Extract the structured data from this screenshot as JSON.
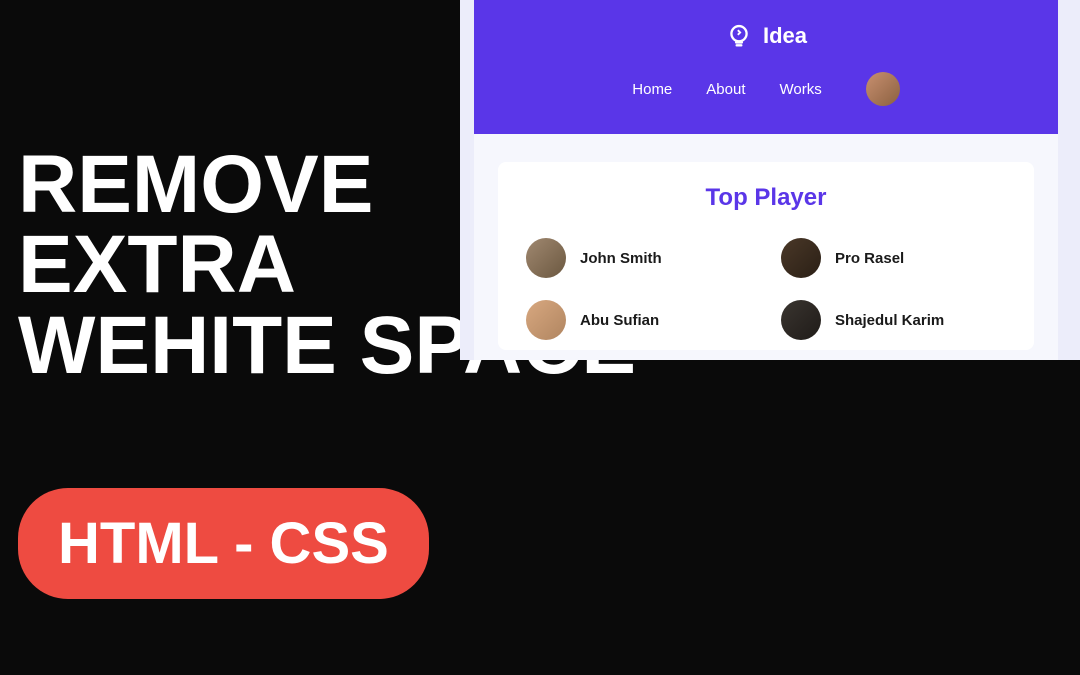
{
  "headline": {
    "line1": "REMOVE",
    "line2": "EXTRA",
    "line3": "WEHITE SPACE"
  },
  "pill": "HTML - CSS",
  "app": {
    "brand": "Idea",
    "nav": {
      "home": "Home",
      "about": "About",
      "works": "Works"
    },
    "card_title": "Top Player",
    "players": [
      {
        "name": "John Smith"
      },
      {
        "name": "Pro Rasel"
      },
      {
        "name": "Abu Sufian"
      },
      {
        "name": "Shajedul Karim"
      }
    ]
  }
}
